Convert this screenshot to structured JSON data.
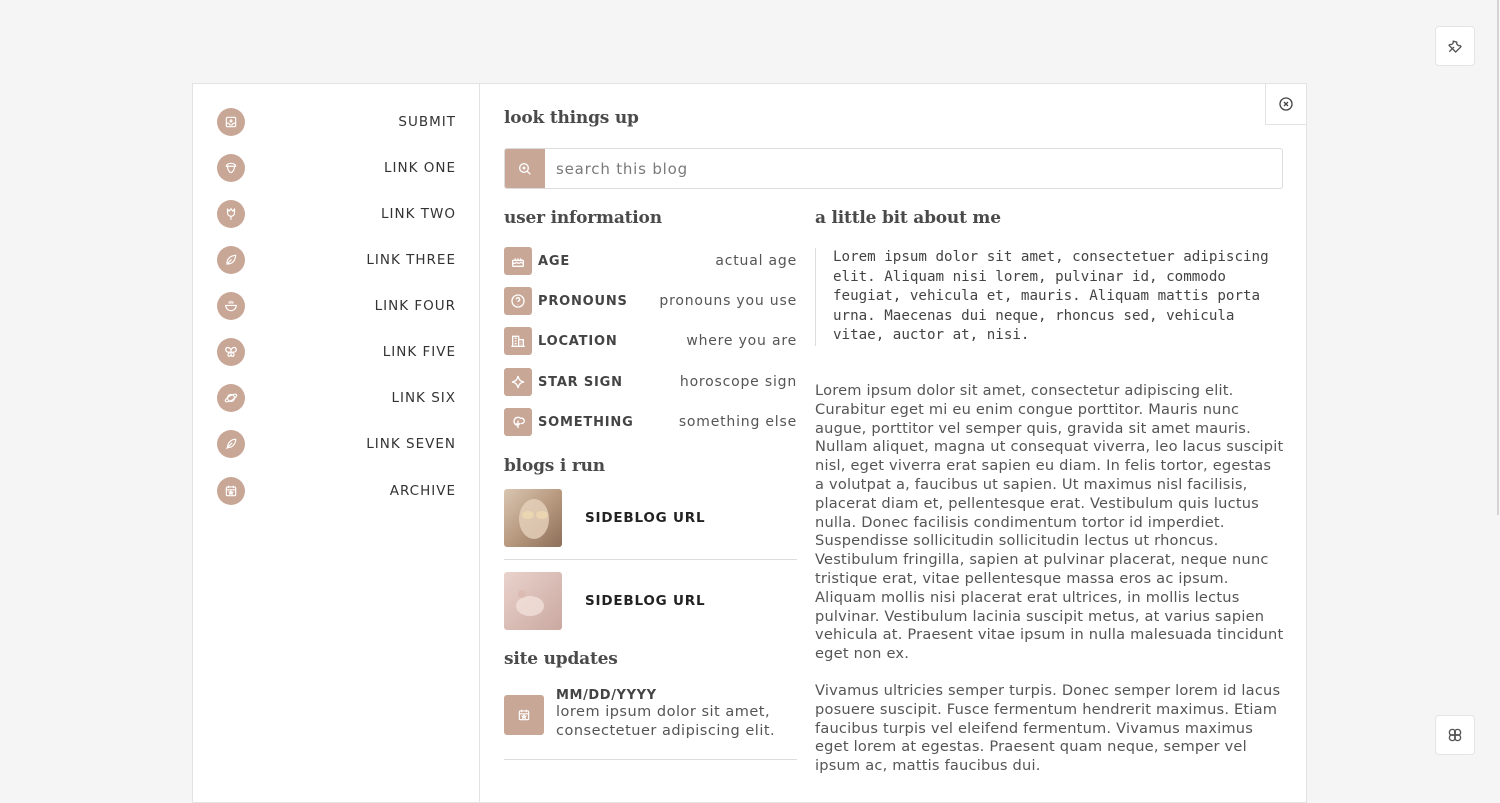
{
  "nav": [
    {
      "label": "SUBMIT",
      "icon": "inbox-icon"
    },
    {
      "label": "LINK ONE",
      "icon": "acorn-icon"
    },
    {
      "label": "LINK TWO",
      "icon": "tulip-icon"
    },
    {
      "label": "LINK THREE",
      "icon": "leaf-icon"
    },
    {
      "label": "LINK FOUR",
      "icon": "bowl-icon"
    },
    {
      "label": "LINK FIVE",
      "icon": "butterfly-icon"
    },
    {
      "label": "LINK SIX",
      "icon": "planet-icon"
    },
    {
      "label": "LINK SEVEN",
      "icon": "feather-icon"
    },
    {
      "label": "ARCHIVE",
      "icon": "calendar-icon"
    }
  ],
  "search": {
    "heading": "look things up",
    "placeholder": "search this blog"
  },
  "user_info": {
    "heading": "user information",
    "rows": [
      {
        "key": "AGE",
        "value": "actual age",
        "icon": "cake-icon"
      },
      {
        "key": "PRONOUNS",
        "value": "pronouns you use",
        "icon": "question-icon"
      },
      {
        "key": "LOCATION",
        "value": "where you are",
        "icon": "building-icon"
      },
      {
        "key": "STAR SIGN",
        "value": "horoscope sign",
        "icon": "sparkle-icon"
      },
      {
        "key": "SOMETHING",
        "value": "something else",
        "icon": "tree-icon"
      }
    ]
  },
  "blogs": {
    "heading": "blogs i run",
    "items": [
      {
        "url": "SIDEBLOG URL"
      },
      {
        "url": "SIDEBLOG URL"
      }
    ]
  },
  "updates": {
    "heading": "site updates",
    "items": [
      {
        "date": "MM/DD/YYYY",
        "text": "lorem ipsum dolor sit amet, consectetuer adipiscing elit."
      }
    ]
  },
  "about": {
    "heading": "a little bit about me",
    "quote": "Lorem ipsum dolor sit amet, consectetuer adipiscing elit. Aliquam nisi lorem, pulvinar id, commodo feugiat, vehicula et, mauris. Aliquam mattis porta urna. Maecenas dui neque, rhoncus sed, vehicula vitae, auctor at, nisi.",
    "paragraphs": [
      "Lorem ipsum dolor sit amet, consectetur adipiscing elit. Curabitur eget mi eu enim congue porttitor. Mauris nunc augue, porttitor vel semper quis, gravida sit amet mauris. Nullam aliquet, magna ut consequat viverra, leo lacus suscipit nisl, eget viverra erat sapien eu diam. In felis tortor, egestas a volutpat a, faucibus ut sapien. Ut maximus nisl facilisis, placerat diam et, pellentesque erat. Vestibulum quis luctus nulla. Donec facilisis condimentum tortor id imperdiet. Suspendisse sollicitudin sollicitudin lectus ut rhoncus. Vestibulum fringilla, sapien at pulvinar placerat, neque nunc tristique erat, vitae pellentesque massa eros ac ipsum. Aliquam mollis nisi placerat erat ultrices, in mollis lectus pulvinar. Vestibulum lacinia suscipit metus, at varius sapien vehicula at. Praesent vitae ipsum in nulla malesuada tincidunt eget non ex.",
      "Vivamus ultricies semper turpis. Donec semper lorem id lacus posuere suscipit. Fusce fermentum hendrerit maximus. Etiam faucibus turpis vel eleifend fermentum. Vivamus maximus eget lorem at egestas. Praesent quam neque, semper vel ipsum ac, mattis faucibus dui."
    ]
  },
  "colors": {
    "accent": "#c9a797",
    "border": "#e3e3e3"
  }
}
